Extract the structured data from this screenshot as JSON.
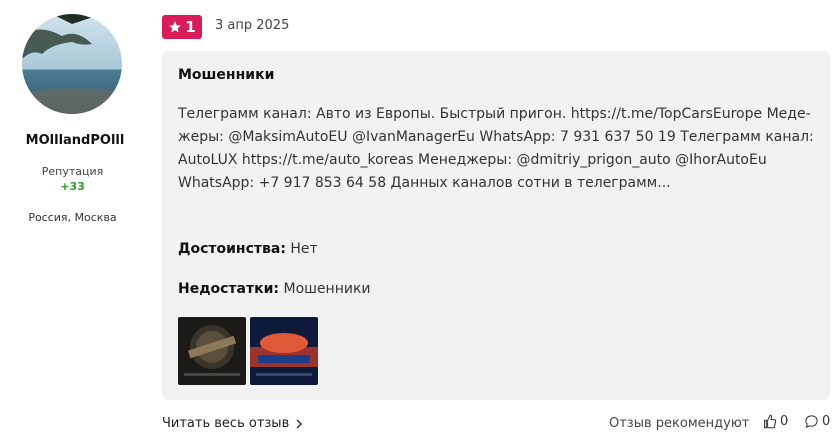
{
  "author": {
    "username": "MOlllandPOlll",
    "reputation_label": "Репутация",
    "reputation_value": "+33",
    "location": "Россия, Москва"
  },
  "review": {
    "rating": "1",
    "date": "3 апр 2025",
    "title": "Мошенники",
    "text": "Телеграмм канал: Авто из Европы. Быстрый пригон. https://t.me/TopCarsEurope Меде­жеры: @MaksimAutoEU @IvanManagerEu WhatsApp: 7 931 637 50 19 Телеграмм канал: AutoLUX https://t.me/auto_koreas Менеджеры: @dmitriy_prigon_auto @IhorAutoEu WhatsApp: +7 917 853 64 58 Данных каналов сотни в телеграмм...",
    "pros_label": "Достоинства:",
    "pros_value": "Нет",
    "cons_label": "Недостатки:",
    "cons_value": "Мошенники"
  },
  "footer": {
    "read_more": "Читать весь отзыв",
    "recommend": "Отзыв рекомендуют",
    "likes": "0",
    "comments": "0"
  },
  "colors": {
    "badge": "#d91c59",
    "card_bg": "#f2f2f3",
    "reputation": "#2e9b2e"
  },
  "icons": [
    "star-icon",
    "chevron-right-icon",
    "thumbs-up-icon",
    "comment-icon"
  ]
}
